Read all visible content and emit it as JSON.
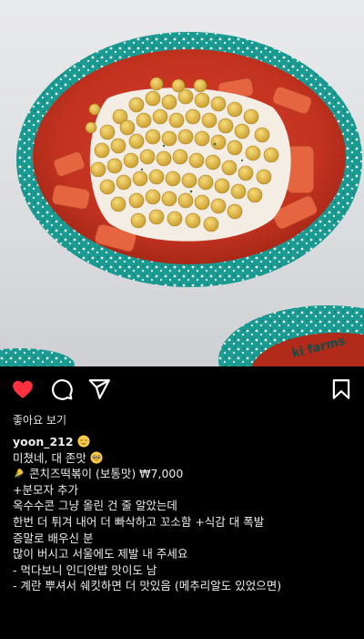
{
  "post": {
    "image": {
      "semantic": "food-photo-corn-cheese-tteokbokki",
      "bowl_text": "ki farms"
    },
    "actions": {
      "like_icon": "heart-filled-icon",
      "comment_icon": "comment-icon",
      "share_icon": "send-icon",
      "save_icon": "bookmark-icon",
      "like_color": "#ff3040"
    },
    "likes_label": "좋아요 보기",
    "caption": {
      "username": "yoon_212",
      "username_emoji": "relieved-face-emoji",
      "lines": [
        "미쳤네, 대 존맛",
        "콘치즈떡볶이 (보통맛) ₩7,000",
        "+분모자 추가",
        "옥수수콘 그냥 올린 건 줄 알았는데",
        "한번 더 튀겨 내어 더 빠삭하고 꼬소함 +식감 대 폭발",
        "증말로 배우신 분",
        "많이 버시고 서울에도 제발 내 주세요",
        "- 먹다보니 인디안밥 맛이도 남",
        "- 계란 뿌셔서 쉐킷하면 더 맛있음 (메추리알도 있었으면)"
      ]
    }
  }
}
